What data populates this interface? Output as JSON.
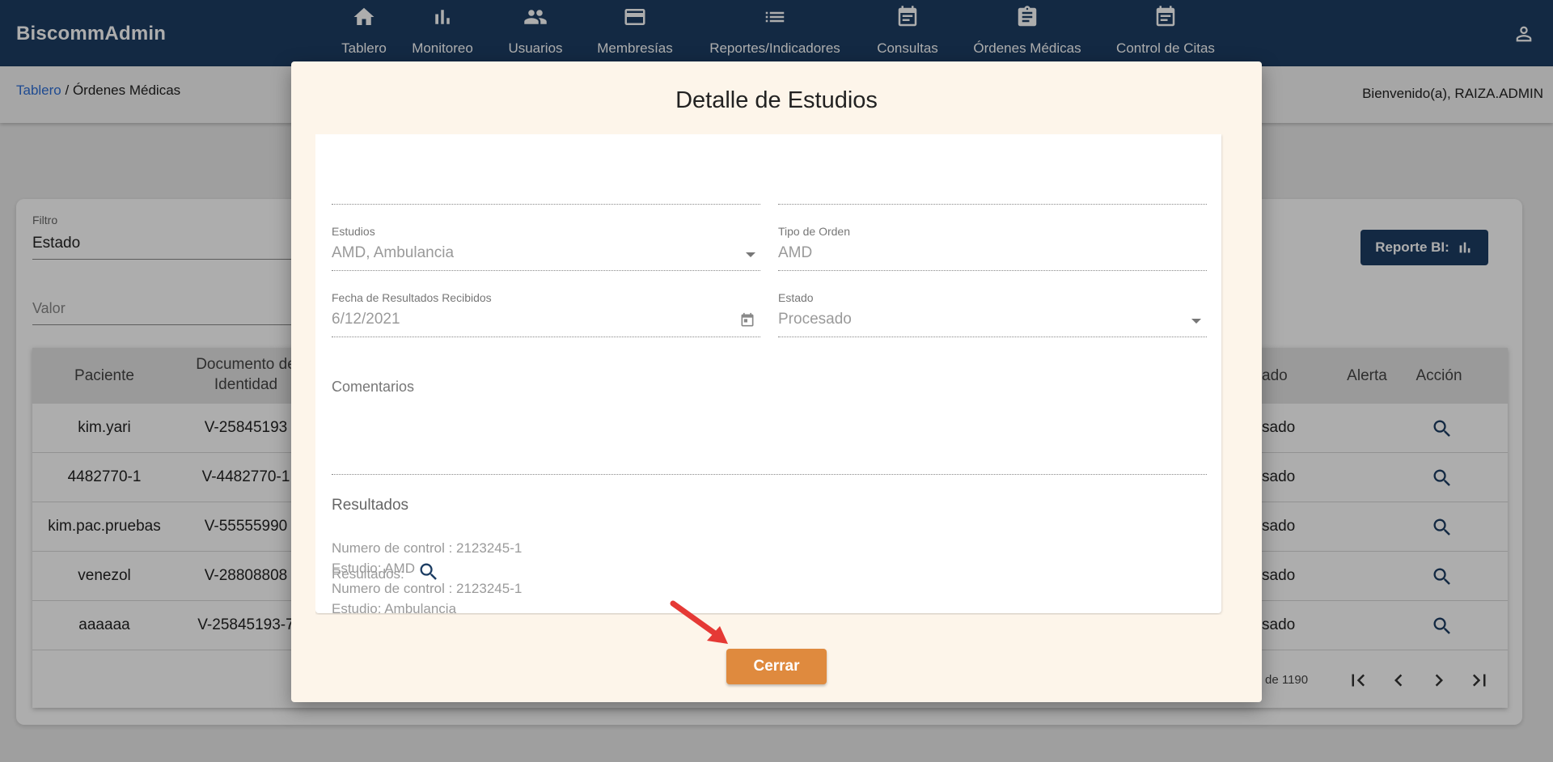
{
  "app": {
    "title": "BiscommAdmin"
  },
  "nav": {
    "items": [
      {
        "label": "Tablero",
        "icon": "home-icon"
      },
      {
        "label": "Monitoreo",
        "icon": "bar-chart-icon"
      },
      {
        "label": "Usuarios",
        "icon": "people-icon"
      },
      {
        "label": "Membresías",
        "icon": "credit-card-icon"
      },
      {
        "label": "Reportes/Indicadores",
        "icon": "list-icon"
      },
      {
        "label": "Consultas",
        "icon": "event-note-icon"
      },
      {
        "label": "Órdenes Médicas",
        "icon": "clipboard-icon"
      },
      {
        "label": "Control de Citas",
        "icon": "event-note-icon"
      }
    ]
  },
  "breadcrumb": {
    "home": "Tablero",
    "separator": " / ",
    "current": "Órdenes Médicas"
  },
  "welcome": "Bienvenido(a), RAIZA.ADMIN",
  "filter": {
    "label": "Filtro",
    "value": "Estado",
    "value_placeholder": "Valor"
  },
  "report_button": {
    "label": "Reporte BI:"
  },
  "table": {
    "headers": {
      "paciente": "Paciente",
      "documento": "Documento de Identidad",
      "estado_partial": "ado",
      "alerta": "Alerta",
      "accion": "Acción"
    },
    "rows": [
      {
        "paciente": "kim.yari",
        "documento": "V-25845193",
        "estado_partial": "sado"
      },
      {
        "paciente": "4482770-1",
        "documento": "V-4482770-1",
        "estado_partial": "sado"
      },
      {
        "paciente": "kim.pac.pruebas",
        "documento": "V-55555990",
        "estado_partial": "sado"
      },
      {
        "paciente": "venezol",
        "documento": "V-28808808",
        "estado_partial": "sado"
      },
      {
        "paciente": "aaaaaa",
        "documento": "V-25845193-7",
        "estado_partial": "sado"
      }
    ],
    "pager_text": "de 1190"
  },
  "modal": {
    "title": "Detalle de Estudios",
    "fields": {
      "estudios": {
        "label": "Estudios",
        "value": "AMD, Ambulancia"
      },
      "tipo_orden": {
        "label": "Tipo de Orden",
        "value": "AMD"
      },
      "fecha_resultados": {
        "label": "Fecha de Resultados Recibidos",
        "value": "6/12/2021"
      },
      "estado": {
        "label": "Estado",
        "value": "Procesado"
      },
      "comentarios": {
        "placeholder": "Comentarios"
      }
    },
    "results": {
      "title": "Resultados",
      "lines": [
        "Numero de control : 2123245-1",
        "Estudio: AMD",
        "Numero de control : 2123245-1",
        "Estudio: Ambulancia"
      ],
      "results_label": "Resultados:"
    },
    "close_button": "Cerrar"
  },
  "colors": {
    "primary": "#1c3d63",
    "accent": "#df8a3e",
    "arrow": "#e53935",
    "modal_bg": "#fdf5ea"
  }
}
